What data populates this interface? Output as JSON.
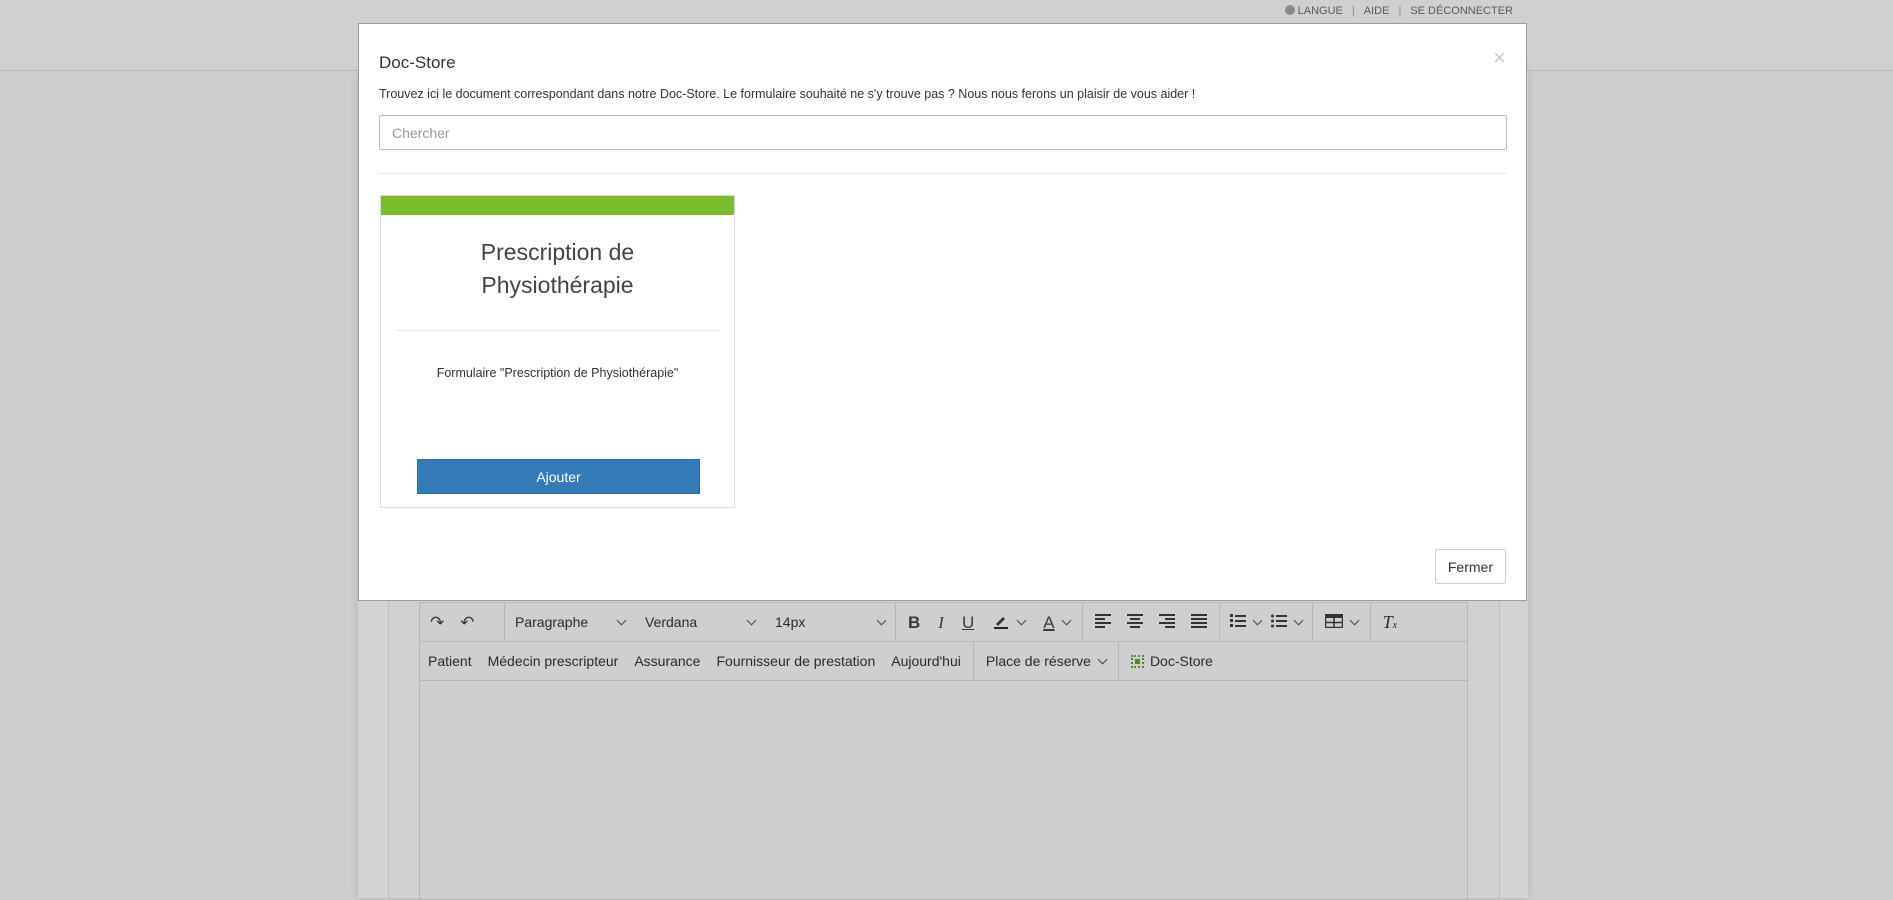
{
  "top_links": {
    "language": "LANGUE",
    "help": "AIDE",
    "logout": "SE DÉCONNECTER",
    "separator": "|"
  },
  "modal": {
    "title": "Doc-Store",
    "close_icon": "×",
    "description": "Trouvez ici le document correspondant dans notre Doc-Store. Le formulaire souhaité ne s'y trouve pas ? Nous nous ferons un plaisir de vous aider !",
    "search_placeholder": "Chercher",
    "search_value": "",
    "cards": [
      {
        "title_line1": "Prescription de",
        "title_line2": "Physiothérapie",
        "description": "Formulaire \"Prescription de Physiothérapie\"",
        "button_label": "Ajouter",
        "accent_color": "#79bd2c"
      }
    ],
    "close_button_label": "Fermer"
  },
  "editor": {
    "toolbar_row1": {
      "redo_icon": "↷",
      "undo_icon": "↶",
      "block_format": "Paragraphe",
      "font_family": "Verdana",
      "font_size": "14px",
      "bold": "B",
      "italic": "I",
      "underline": "U",
      "text_color": "A"
    },
    "toolbar_row2": {
      "items": [
        "Patient",
        "Médecin prescripteur",
        "Assurance",
        "Fournisseur de prestation",
        "Aujourd'hui"
      ],
      "placeholder_menu": "Place de réserve",
      "docstore": "Doc-Store"
    }
  },
  "colors": {
    "primary_button": "#337ab7",
    "card_accent": "#79bd2c",
    "overlay_background": "#cfcfcf"
  }
}
